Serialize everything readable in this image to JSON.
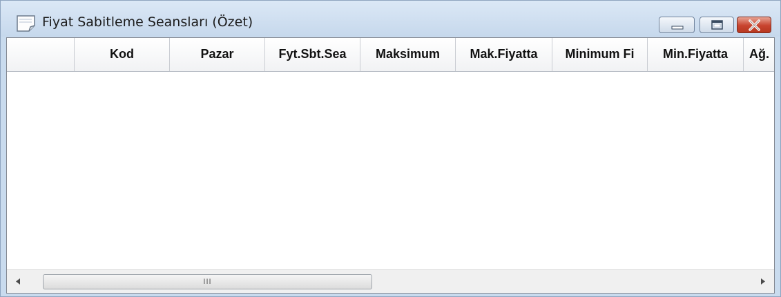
{
  "window": {
    "title": "Fiyat Sabitleme Seansları (Özet)",
    "icon": "notepad-icon",
    "controls": [
      "minimize-icon",
      "maximize-icon",
      "close-icon"
    ],
    "accent_close": "#c8442f"
  },
  "table": {
    "columns": [
      {
        "label": ""
      },
      {
        "label": "Kod"
      },
      {
        "label": "Pazar"
      },
      {
        "label": "Fyt.Sbt.Sea"
      },
      {
        "label": "Maksimum"
      },
      {
        "label": "Mak.Fiyatta"
      },
      {
        "label": "Minimum Fi"
      },
      {
        "label": "Min.Fiyatta"
      },
      {
        "label": "Ağ."
      }
    ],
    "rows": []
  },
  "scrollbar": {
    "grip": "III",
    "left_arrow": "◀",
    "right_arrow": "▶"
  }
}
